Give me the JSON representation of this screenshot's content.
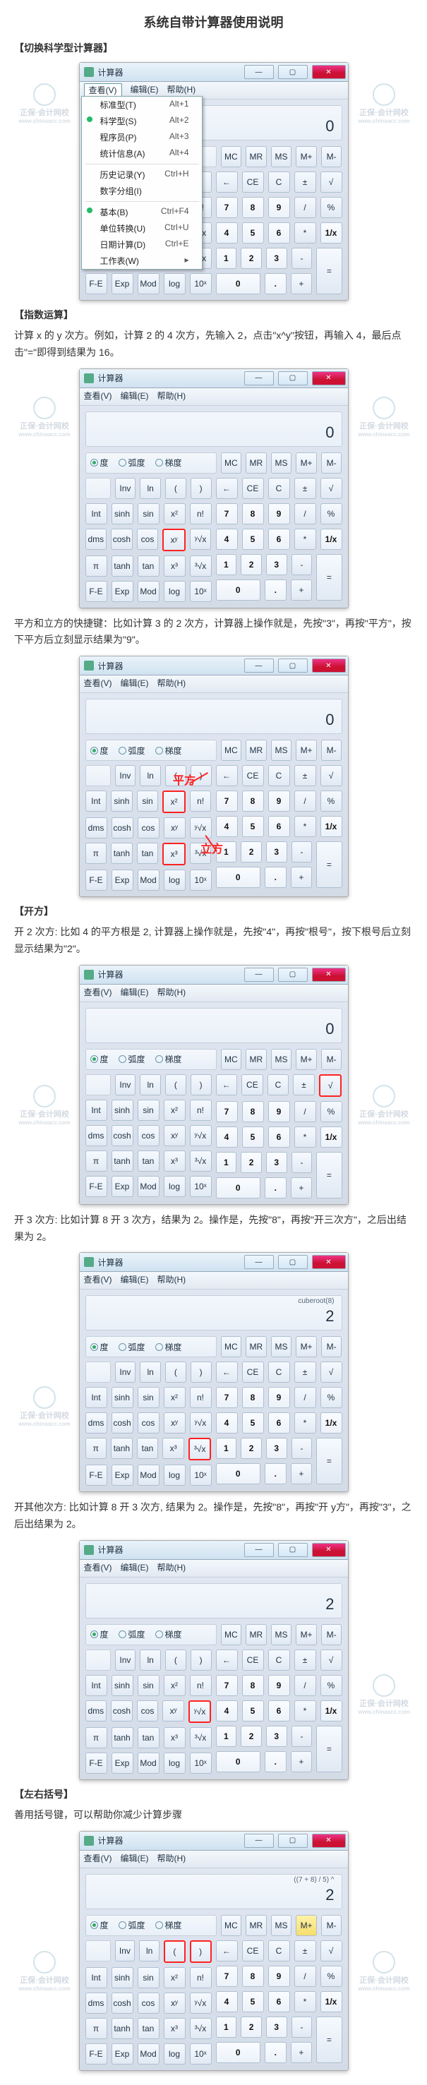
{
  "title": "系统自带计算器使用说明",
  "sections": {
    "s1": {
      "head": "【切换科学型计算器】"
    },
    "s2": {
      "head": "【指数运算】",
      "para1": "计算 x 的 y 次方。例如，计算 2 的 4 次方，先输入 2，点击\"x^y\"按钮，再输入 4，最后点击\"=\"即得到结果为 16。",
      "para2": "平方和立方的快捷键：比如计算 3 的 2 次方，计算器上操作就是，先按\"3\"，再按\"平方\"，按下平方后立刻显示结果为\"9\"。"
    },
    "s3": {
      "head": "【开方】",
      "para1": "开 2 次方: 比如 4 的平方根是 2, 计算器上操作就是，先按\"4\"，再按\"根号\"，按下根号后立刻显示结果为\"2\"。",
      "para2": "开 3 次方: 比如计算 8 开 3 次方，结果为 2。操作是，先按\"8\"，再按\"开三次方\"，之后出结果为 2。",
      "para3": "开其他次方: 比如计算 8 开 3 次方, 结果为 2。操作是，先按\"8\"，再按\"开 y方\"，再按\"3\"，之后出结果为 2。"
    },
    "s4": {
      "head": "【左右括号】",
      "para1": "善用括号键，可以帮助你减少计算步骤"
    }
  },
  "calc": {
    "title": "计算器",
    "menu": {
      "view": "查看(V)",
      "edit": "编辑(E)",
      "help": "帮助(H)"
    },
    "modes": {
      "deg": "度",
      "rad": "弧度",
      "grad": "梯度"
    },
    "mem": [
      "MC",
      "MR",
      "MS",
      "M+",
      "M-"
    ],
    "memPlusY": "M+",
    "disp_zero": "0",
    "left": {
      "r0": [
        "",
        "Inv",
        "ln",
        "(",
        ")"
      ],
      "r1": [
        "Int",
        "sinh",
        "sin",
        "x²",
        "n!"
      ],
      "r2": [
        "dms",
        "cosh",
        "cos",
        "xʸ",
        "ʸ√x"
      ],
      "r3": [
        "π",
        "tanh",
        "tan",
        "x³",
        "³√x"
      ],
      "r4": [
        "F-E",
        "Exp",
        "Mod",
        "log",
        "10ˣ"
      ]
    },
    "right": {
      "r0": [
        "←",
        "CE",
        "C",
        "±",
        "√"
      ],
      "r1": [
        "7",
        "8",
        "9",
        "/",
        "%"
      ],
      "r2": [
        "4",
        "5",
        "6",
        "*",
        "1/x"
      ],
      "r3": [
        "1",
        "2",
        "3",
        "-",
        "="
      ],
      "r4": [
        "0",
        ".",
        "+"
      ]
    },
    "menu_items": [
      {
        "label": "标准型(T)",
        "acc": "Alt+1"
      },
      {
        "label": "科学型(S)",
        "acc": "Alt+2",
        "checked": true
      },
      {
        "label": "程序员(P)",
        "acc": "Alt+3"
      },
      {
        "label": "统计信息(A)",
        "acc": "Alt+4"
      },
      {
        "sep": true
      },
      {
        "label": "历史记录(Y)",
        "acc": "Ctrl+H"
      },
      {
        "label": "数字分组(I)"
      },
      {
        "sep": true
      },
      {
        "label": "基本(B)",
        "acc": "Ctrl+F4",
        "checked": true
      },
      {
        "label": "单位转换(U)",
        "acc": "Ctrl+U"
      },
      {
        "label": "日期计算(D)",
        "acc": "Ctrl+E"
      },
      {
        "label": "工作表(W)",
        "arrow": true
      }
    ],
    "aux_cuberoot": "cuberoot(8)",
    "disp_two": "2",
    "aux_paren": "((7 + 8) / 5) ^",
    "disp_paren": "2"
  },
  "annot": {
    "sq": "平方",
    "cu": "立方"
  },
  "watermark": {
    "brand": "正保·会计网校",
    "url": "www.chinaacc.com"
  }
}
